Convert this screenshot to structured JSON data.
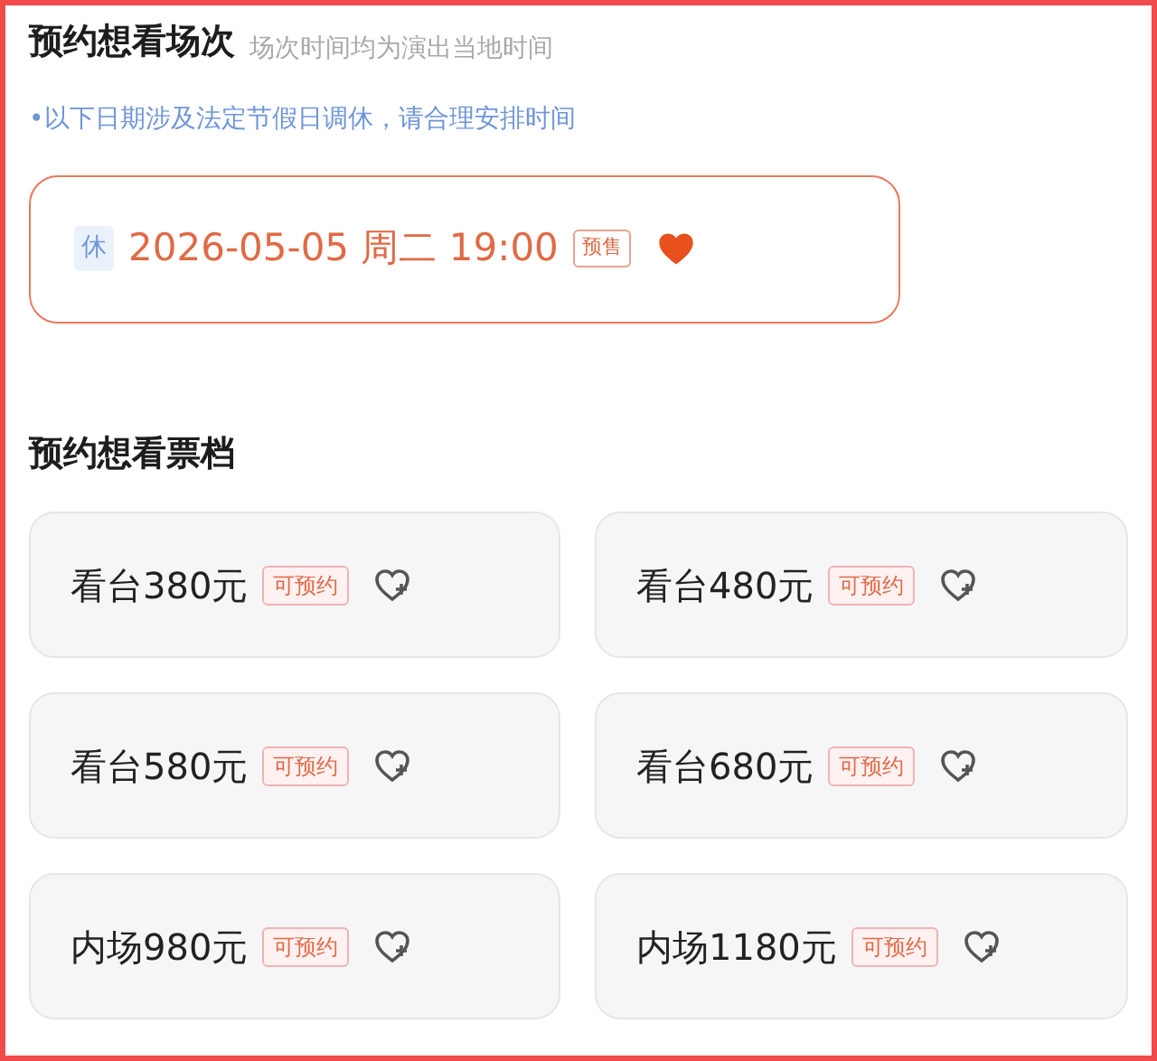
{
  "session_section": {
    "title": "预约想看场次",
    "subtitle": "场次时间均为演出当地时间",
    "note": "•以下日期涉及法定节假日调休，请合理安排时间"
  },
  "sessions": [
    {
      "holiday_tag": "休",
      "datetime": "2026-05-05 周二 19:00",
      "status": "预售",
      "selected": true,
      "favorited": true
    }
  ],
  "tier_section": {
    "title": "预约想看票档"
  },
  "tiers": [
    {
      "name": "看台380元",
      "status": "可预约",
      "selected": false,
      "favorited": false
    },
    {
      "name": "看台480元",
      "status": "可预约",
      "selected": false,
      "favorited": false
    },
    {
      "name": "看台580元",
      "status": "可预约",
      "selected": false,
      "favorited": false
    },
    {
      "name": "看台680元",
      "status": "可预约",
      "selected": false,
      "favorited": false
    },
    {
      "name": "内场980元",
      "status": "可预约",
      "selected": false,
      "favorited": false
    },
    {
      "name": "内场1180元",
      "status": "可预约",
      "selected": false,
      "favorited": false
    }
  ]
}
